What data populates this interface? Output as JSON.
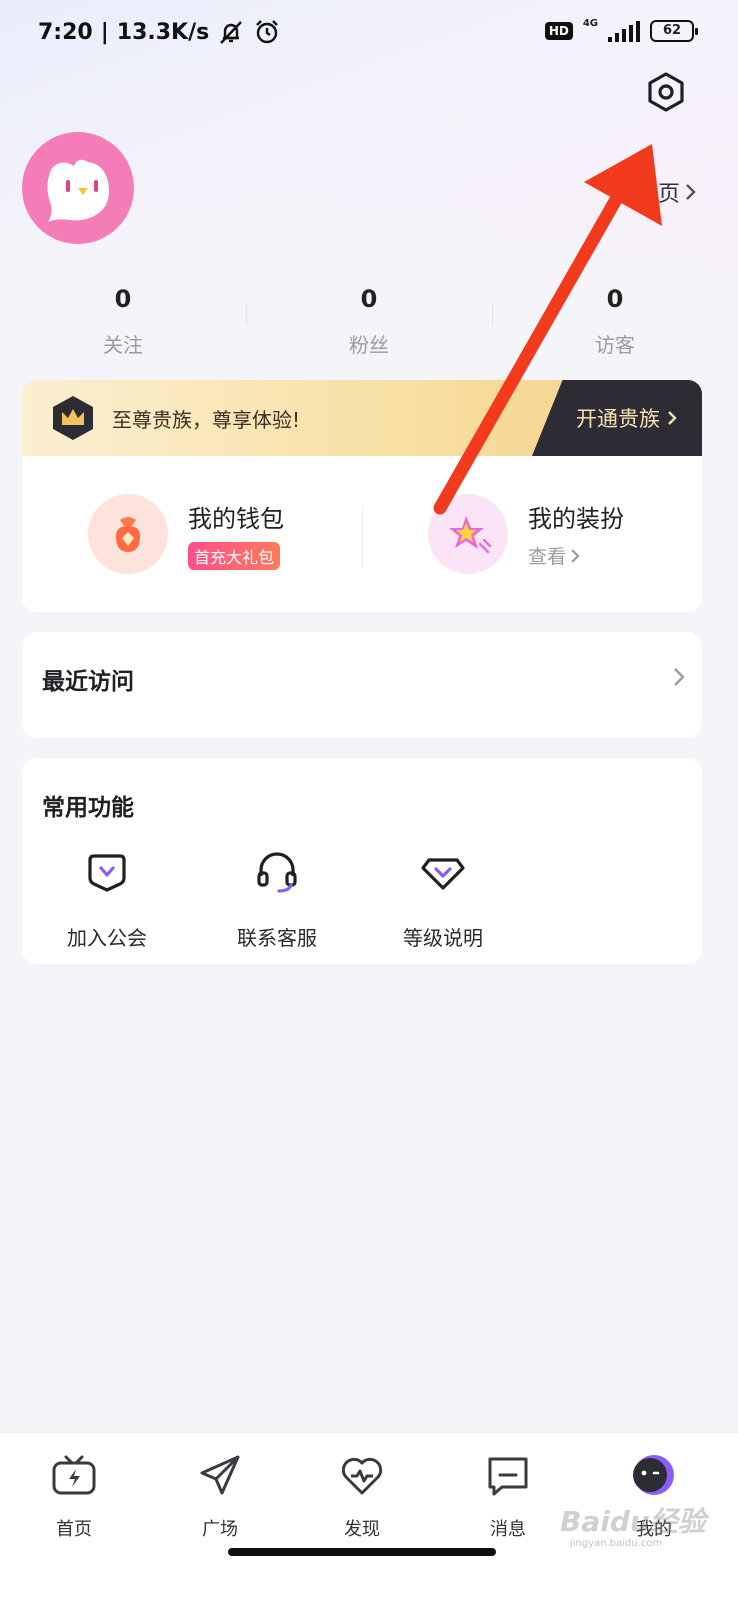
{
  "status_bar": {
    "time": "7:20",
    "separator": "|",
    "speed": "13.3K/s",
    "hd_label": "HD",
    "network": "4G",
    "battery": "62"
  },
  "header": {
    "homepage_label": "主页"
  },
  "stats": [
    {
      "count": "0",
      "label": "关注"
    },
    {
      "count": "0",
      "label": "粉丝"
    },
    {
      "count": "0",
      "label": "访客"
    }
  ],
  "vip": {
    "text": "至尊贵族，尊享体验!",
    "button_label": "开通贵族"
  },
  "wallet": {
    "title": "我的钱包",
    "badge": "首充大礼包"
  },
  "dressup": {
    "title": "我的装扮",
    "sub": "查看"
  },
  "recent": {
    "title": "最近访问"
  },
  "functions": {
    "title": "常用功能",
    "items": [
      {
        "label": "加入公会",
        "icon": "guild-icon"
      },
      {
        "label": "联系客服",
        "icon": "headset-icon"
      },
      {
        "label": "等级说明",
        "icon": "level-icon"
      }
    ]
  },
  "bottom_nav": [
    {
      "label": "首页",
      "icon": "tv-icon"
    },
    {
      "label": "广场",
      "icon": "paper-plane-icon"
    },
    {
      "label": "发现",
      "icon": "heart-pulse-icon"
    },
    {
      "label": "消息",
      "icon": "message-icon"
    },
    {
      "label": "我的",
      "icon": "profile-icon"
    }
  ],
  "watermark": {
    "brand": "Baidu经验",
    "url": "jingyan.baidu.com"
  },
  "colors": {
    "accent": "#8b5cf6",
    "avatar_bg": "#f47db7",
    "arrow": "#f23a1c"
  }
}
